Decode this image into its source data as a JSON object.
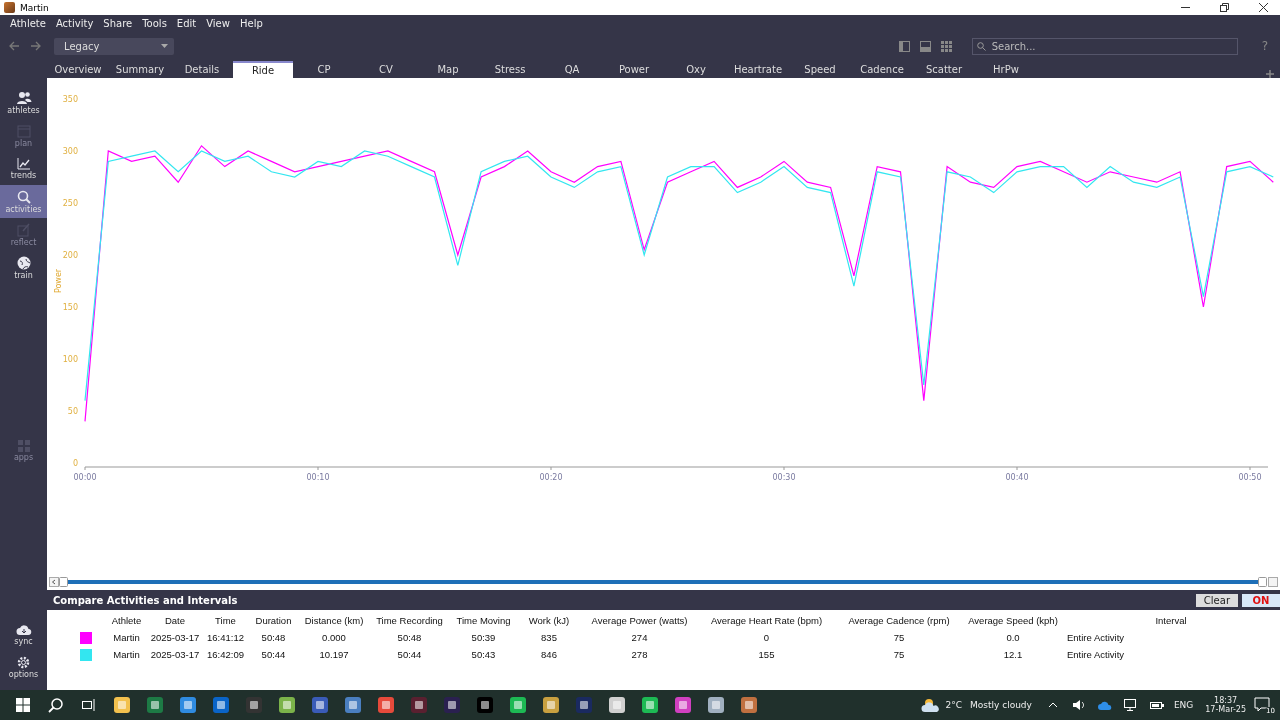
{
  "window": {
    "title": "Martin"
  },
  "menu": [
    "Athlete",
    "Activity",
    "Share",
    "Tools",
    "Edit",
    "View",
    "Help"
  ],
  "toolbar": {
    "view": "Legacy",
    "search": {
      "placeholder": "Search..."
    },
    "help": "?"
  },
  "tabs": [
    {
      "label": "Overview",
      "selected": false
    },
    {
      "label": "Summary",
      "selected": false
    },
    {
      "label": "Details",
      "selected": false
    },
    {
      "label": "Ride",
      "selected": true
    },
    {
      "label": "CP",
      "selected": false
    },
    {
      "label": "CV",
      "selected": false
    },
    {
      "label": "Map",
      "selected": false
    },
    {
      "label": "Stress",
      "selected": false
    },
    {
      "label": "QA",
      "selected": false
    },
    {
      "label": "Power",
      "selected": false
    },
    {
      "label": "Oxy",
      "selected": false
    },
    {
      "label": "Heartrate",
      "selected": false
    },
    {
      "label": "Speed",
      "selected": false
    },
    {
      "label": "Cadence",
      "selected": false
    },
    {
      "label": "Scatter",
      "selected": false
    },
    {
      "label": "HrPw",
      "selected": false
    }
  ],
  "sidebar": {
    "items": [
      {
        "kind": "athletes",
        "label": "athletes",
        "selected": false,
        "disabled": false
      },
      {
        "kind": "plan",
        "label": "plan",
        "selected": false,
        "disabled": true
      },
      {
        "kind": "trends",
        "label": "trends",
        "selected": false,
        "disabled": false
      },
      {
        "kind": "activities",
        "label": "activities",
        "selected": true,
        "disabled": false
      },
      {
        "kind": "reflect",
        "label": "reflect",
        "selected": false,
        "disabled": true
      },
      {
        "kind": "train",
        "label": "train",
        "selected": false,
        "disabled": false
      },
      {
        "kind": "apps",
        "label": "apps",
        "selected": false,
        "disabled": true
      }
    ],
    "bottom_items": [
      {
        "kind": "sync",
        "label": "sync"
      },
      {
        "kind": "options",
        "label": "options"
      }
    ]
  },
  "chart": {
    "chart_data": {
      "type": "line",
      "ylabel": "Power",
      "xlim": [
        0,
        51
      ],
      "ylim": [
        0,
        350
      ],
      "xticks": [
        {
          "value": 0,
          "label": "00:00"
        },
        {
          "value": 10,
          "label": "00:10"
        },
        {
          "value": 20,
          "label": "00:20"
        },
        {
          "value": 30,
          "label": "00:30"
        },
        {
          "value": 40,
          "label": "00:40"
        },
        {
          "value": 50,
          "label": "00:50"
        }
      ],
      "yticks": [
        0,
        50,
        100,
        150,
        200,
        250,
        300,
        350
      ],
      "x": [
        0,
        1,
        2,
        3,
        4,
        5,
        6,
        7,
        8,
        9,
        10,
        11,
        12,
        13,
        14,
        15,
        16,
        17,
        18,
        19,
        20,
        21,
        22,
        23,
        24,
        25,
        26,
        27,
        28,
        29,
        30,
        31,
        32,
        33,
        34,
        35,
        36,
        37,
        38,
        39,
        40,
        41,
        42,
        43,
        44,
        45,
        46,
        47,
        48,
        49,
        50,
        51
      ],
      "series": [
        {
          "color": "#ff00ff",
          "values": [
            40,
            300,
            290,
            295,
            270,
            305,
            285,
            300,
            290,
            280,
            285,
            290,
            295,
            300,
            290,
            280,
            200,
            275,
            285,
            300,
            280,
            270,
            285,
            290,
            205,
            270,
            280,
            290,
            265,
            275,
            290,
            270,
            265,
            180,
            285,
            280,
            60,
            285,
            270,
            265,
            285,
            290,
            280,
            270,
            280,
            275,
            270,
            280,
            150,
            285,
            290,
            270
          ]
        },
        {
          "color": "#33e6f0",
          "values": [
            60,
            290,
            295,
            300,
            280,
            300,
            290,
            295,
            280,
            275,
            290,
            285,
            300,
            295,
            285,
            275,
            190,
            280,
            290,
            295,
            275,
            265,
            280,
            285,
            200,
            275,
            285,
            285,
            260,
            270,
            285,
            265,
            260,
            170,
            280,
            275,
            75,
            280,
            275,
            260,
            280,
            285,
            285,
            265,
            285,
            270,
            265,
            275,
            160,
            280,
            285,
            275
          ]
        }
      ]
    }
  },
  "compare": {
    "title": "Compare Activities and Intervals",
    "clear": "Clear",
    "toggle": {
      "label": "ON",
      "on": true
    },
    "columns": [
      "Athlete",
      "Date",
      "Time",
      "Duration",
      "Distance (km)",
      "Time Recording",
      "Time Moving",
      "Work (kJ)",
      "Average Power (watts)",
      "Average Heart Rate (bpm)",
      "Average Cadence (rpm)",
      "Average Speed (kph)",
      "Interval"
    ],
    "rows": [
      {
        "color": "#ff00ff",
        "cells": [
          "Martin",
          "2025-03-17",
          "16:41:12",
          "50:48",
          "0.000",
          "50:48",
          "50:39",
          "835",
          "274",
          "0",
          "75",
          "0.0",
          "Entire Activity"
        ]
      },
      {
        "color": "#33e6f0",
        "cells": [
          "Martin",
          "2025-03-17",
          "16:42:09",
          "50:44",
          "10.197",
          "50:44",
          "50:43",
          "846",
          "278",
          "155",
          "75",
          "12.1",
          "Entire Activity"
        ]
      }
    ]
  },
  "taskbar": {
    "weather": {
      "temp": "2°C",
      "text": "Mostly cloudy"
    },
    "language": "ENG",
    "time": "18:37",
    "date": "17-Mar-25",
    "notifications": "10"
  }
}
